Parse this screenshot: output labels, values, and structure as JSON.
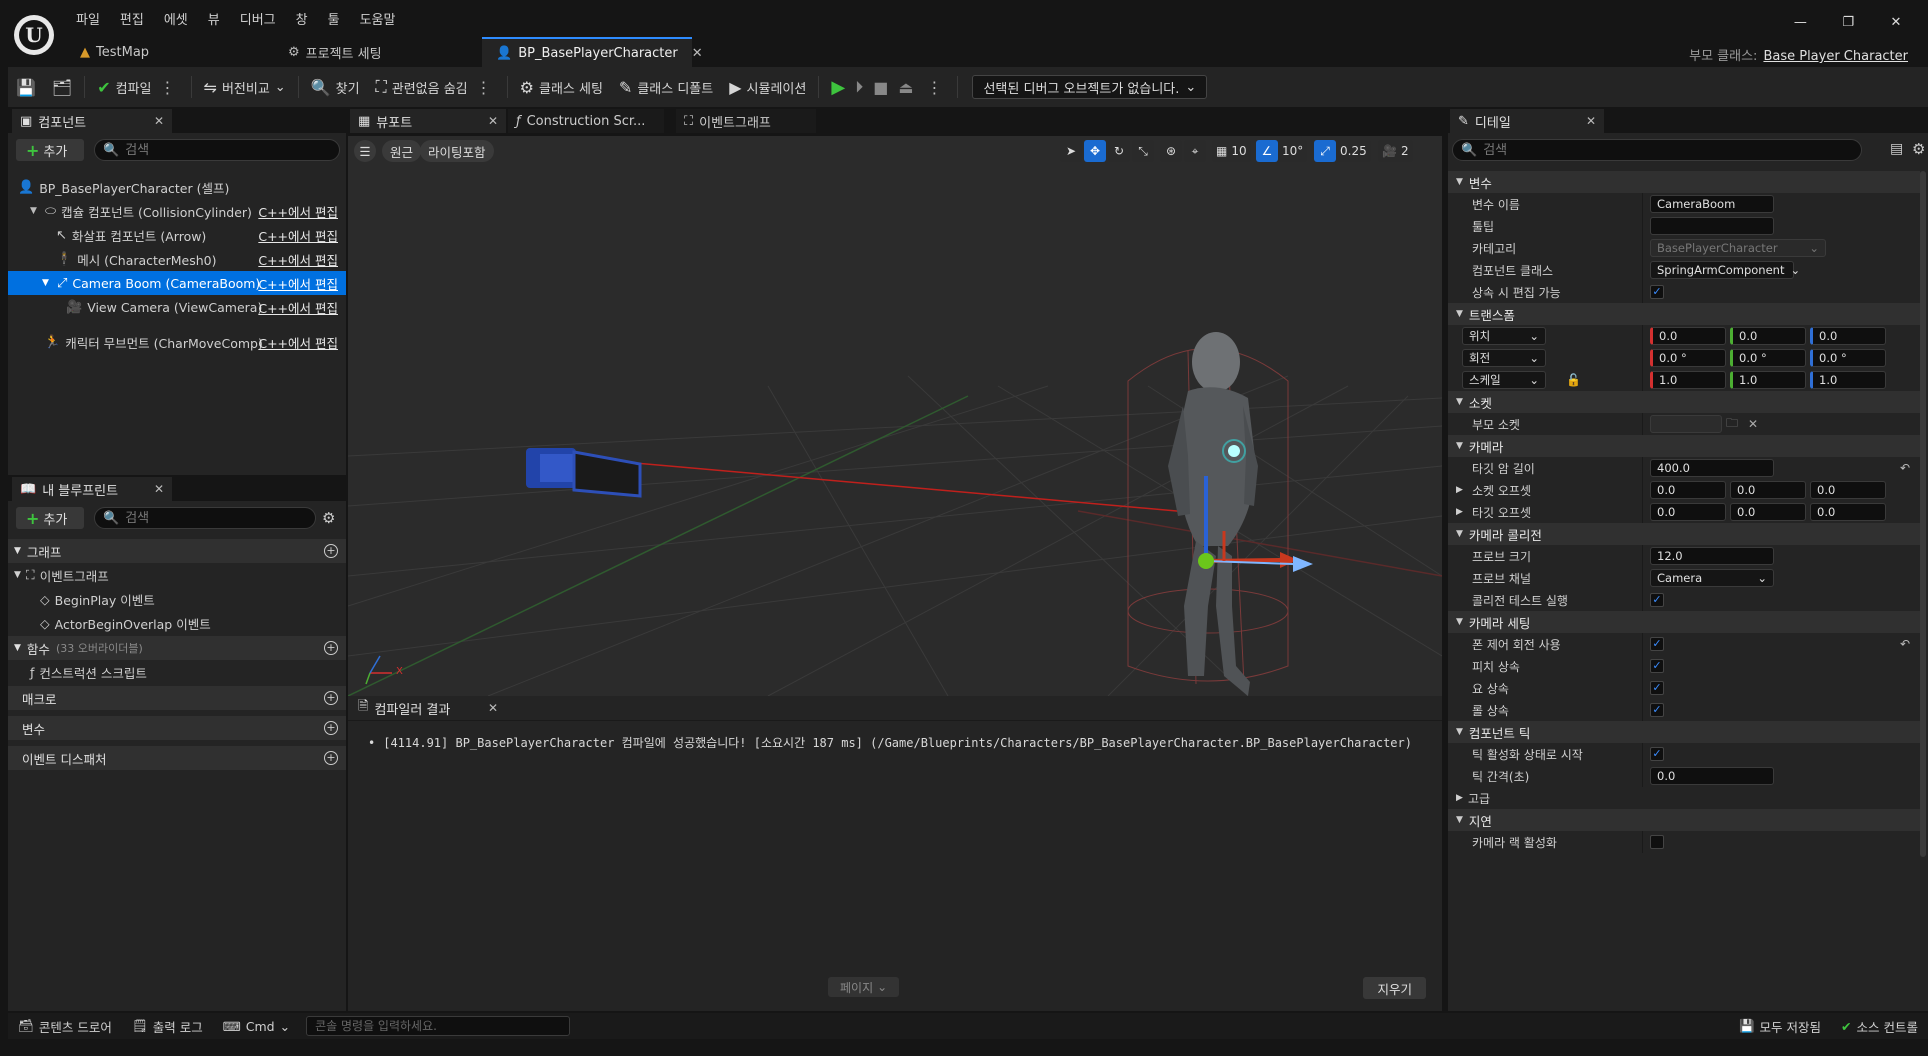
{
  "menu": [
    "파일",
    "편집",
    "에셋",
    "뷰",
    "디버그",
    "창",
    "툴",
    "도움말"
  ],
  "doc_tabs": [
    {
      "label": "TestMap"
    },
    {
      "label": "프로젝트 세팅"
    },
    {
      "label": "BP_BasePlayerCharacter"
    }
  ],
  "parent_class": {
    "label": "부모 클래스:",
    "value": "Base Player Character"
  },
  "toolbar": {
    "compile": "컴파일",
    "diff": "버전비교",
    "find": "찾기",
    "hide_unrelated": "관련없음 숨김",
    "class_settings": "클래스 세팅",
    "class_defaults": "클래스 디폴트",
    "simulation": "시뮬레이션",
    "debug_object": "선택된 디버그 오브젝트가 없습니다."
  },
  "components": {
    "tab": "컴포넌트",
    "add": "추가",
    "search_placeholder": "검색",
    "edit_label": "C++에서 편집",
    "root": "BP_BasePlayerCharacter (셀프)",
    "items": [
      {
        "label": "캡슐 컴포넌트 (CollisionCylinder)"
      },
      {
        "label": "화살표 컴포넌트 (Arrow)"
      },
      {
        "label": "메시 (CharacterMesh0)"
      },
      {
        "label": "Camera Boom (CameraBoom)"
      },
      {
        "label": "View Camera (ViewCamera)"
      },
      {
        "label": "캐릭터 무브먼트 (CharMoveComp)"
      }
    ]
  },
  "my_blueprint": {
    "tab": "내 블루프린트",
    "add": "추가",
    "search_placeholder": "검색",
    "graphs": "그래프",
    "event_graph": "이벤트그래프",
    "events": [
      "BeginPlay 이벤트",
      "ActorBeginOverlap 이벤트"
    ],
    "functions": "함수",
    "functions_count": "(33 오버라이더블)",
    "construction_script": "컨스트럭션 스크립트",
    "macros": "매크로",
    "variables": "변수",
    "dispatchers": "이벤트 디스패처"
  },
  "center_tabs": [
    "뷰포트",
    "Construction Scr...",
    "이벤트그래프"
  ],
  "viewport": {
    "perspective": "원근",
    "lighting": "라이팅포함",
    "grid": "10",
    "rotation": "10°",
    "scale": "0.25",
    "camera_speed": "2",
    "axis_x": "X"
  },
  "compiler": {
    "tab": "컴파일러 결과",
    "message": "[4114.91] BP_BasePlayerCharacter 컴파일에 성공했습니다! [소요시간 187 ms] (/Game/Blueprints/Characters/BP_BasePlayerCharacter.BP_BasePlayerCharacter)",
    "page": "페이지",
    "clear": "지우기"
  },
  "details": {
    "tab": "디테일",
    "search_placeholder": "검색",
    "sections": {
      "variable": "변수",
      "transform": "트랜스폼",
      "socket": "소켓",
      "camera": "카메라",
      "camera_collision": "카메라 콜리전",
      "camera_settings": "카메라 세팅",
      "component_tick": "컴포넌트 틱",
      "advanced": "고급",
      "lag": "지연"
    },
    "rows": {
      "var_name": {
        "label": "변수 이름",
        "value": "CameraBoom"
      },
      "tooltip": {
        "label": "툴팁",
        "value": ""
      },
      "category": {
        "label": "카테고리",
        "value": "BasePlayerCharacter"
      },
      "component_class": {
        "label": "컴포넌트 클래스",
        "value": "SpringArmComponent"
      },
      "editable_on_inherit": {
        "label": "상속 시 편집 가능"
      },
      "location": {
        "label": "위치",
        "x": "0.0",
        "y": "0.0",
        "z": "0.0"
      },
      "rotation": {
        "label": "회전",
        "x": "0.0 °",
        "y": "0.0 °",
        "z": "0.0 °"
      },
      "scale": {
        "label": "스케일",
        "x": "1.0",
        "y": "1.0",
        "z": "1.0"
      },
      "parent_socket": {
        "label": "부모 소켓"
      },
      "target_arm_length": {
        "label": "타깃 암 길이",
        "value": "400.0"
      },
      "socket_offset": {
        "label": "소켓 오프셋",
        "x": "0.0",
        "y": "0.0",
        "z": "0.0"
      },
      "target_offset": {
        "label": "타깃 오프셋",
        "x": "0.0",
        "y": "0.0",
        "z": "0.0"
      },
      "probe_size": {
        "label": "프로브 크기",
        "value": "12.0"
      },
      "probe_channel": {
        "label": "프로브 채널",
        "value": "Camera"
      },
      "do_collision_test": {
        "label": "콜리전 테스트 실행"
      },
      "use_pawn_control_rotation": {
        "label": "폰 제어 회전 사용"
      },
      "inherit_pitch": {
        "label": "피치 상속"
      },
      "inherit_yaw": {
        "label": "요 상속"
      },
      "inherit_roll": {
        "label": "롤 상속"
      },
      "start_with_tick_enabled": {
        "label": "틱 활성화 상태로 시작"
      },
      "tick_interval": {
        "label": "틱 간격(초)",
        "value": "0.0"
      },
      "enable_camera_lag": {
        "label": "카메라 랙 활성화"
      }
    }
  },
  "status": {
    "content_drawer": "콘텐츠 드로어",
    "output_log": "출력 로그",
    "cmd": "Cmd",
    "console_placeholder": "콘솔 명령을 입력하세요.",
    "save_all": "모두 저장됨",
    "source_control": "소스 컨트롤"
  },
  "colors": {
    "accent": "#0070e0",
    "play_green": "#3ec43e",
    "bg_dark": "#151515",
    "panel": "#242424"
  }
}
